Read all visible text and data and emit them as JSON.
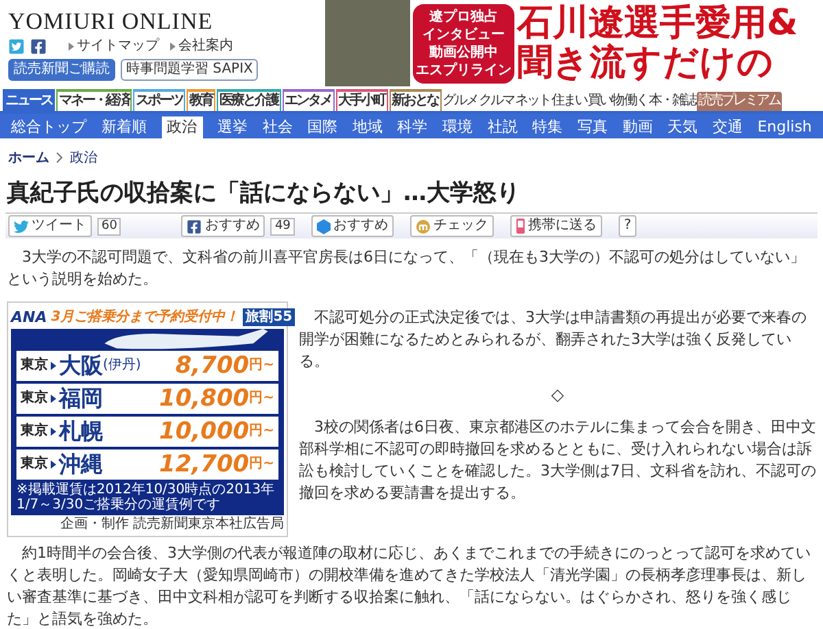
{
  "header": {
    "logo": "YOMIURI ONLINE",
    "links": [
      "サイトマップ",
      "会社案内"
    ],
    "buttons": [
      {
        "label": "読売新聞ご購読",
        "kind": "primary"
      },
      {
        "label": "時事問題学習 SAPIX",
        "kind": "outline"
      }
    ]
  },
  "banner_ad": {
    "badge_lines": [
      "遼プロ独占",
      "インタビュー",
      "動画公開中",
      "エスプリライン"
    ],
    "headline_lines": [
      "石川遼選手愛用&",
      "聞き流すだけの"
    ]
  },
  "nav_primary": {
    "tabs": [
      {
        "label": "ニュース",
        "selected": true,
        "color": "#3366cc"
      },
      {
        "label": "マネー・経済",
        "selected": false,
        "color": "#66aa44"
      },
      {
        "label": "スポーツ",
        "selected": false,
        "color": "#55aadd"
      },
      {
        "label": "教育",
        "selected": false,
        "color": "#ee9933"
      },
      {
        "label": "医療と介護",
        "selected": false,
        "color": "#33aaaa"
      },
      {
        "label": "エンタメ",
        "selected": false,
        "color": "#9966cc"
      },
      {
        "label": "大手小町",
        "selected": false,
        "color": "#dd5577"
      },
      {
        "label": "新おとな",
        "selected": false,
        "color": "#aa8855"
      }
    ],
    "links": [
      "グルメ",
      "クルマ",
      "ネット",
      "住まい",
      "買い物",
      "働く",
      "本・雑誌"
    ],
    "premium": "読売プレミアム"
  },
  "nav_sections": [
    {
      "label": "総合トップ",
      "selected": false
    },
    {
      "label": "新着順",
      "selected": false
    },
    {
      "label": "政治",
      "selected": true
    },
    {
      "label": "選挙",
      "selected": false
    },
    {
      "label": "社会",
      "selected": false
    },
    {
      "label": "国際",
      "selected": false
    },
    {
      "label": "地域",
      "selected": false
    },
    {
      "label": "科学",
      "selected": false
    },
    {
      "label": "環境",
      "selected": false
    },
    {
      "label": "社説",
      "selected": false
    },
    {
      "label": "特集",
      "selected": false
    },
    {
      "label": "写真",
      "selected": false
    },
    {
      "label": "動画",
      "selected": false
    },
    {
      "label": "天気",
      "selected": false
    },
    {
      "label": "交通",
      "selected": false
    },
    {
      "label": "English",
      "selected": false
    }
  ],
  "breadcrumb": [
    "ホーム",
    "政治"
  ],
  "title": "真紀子氏の収拾案に「話にならない」…大学怒り",
  "share_bar": [
    {
      "kind": "tweet",
      "label": "ツイート",
      "count": "60"
    },
    {
      "kind": "facebook",
      "label": "おすすめ",
      "count": "49"
    },
    {
      "kind": "hex",
      "label": "おすすめ"
    },
    {
      "kind": "check",
      "label": "チェック"
    },
    {
      "kind": "mobile",
      "label": "携帯に送る"
    },
    {
      "kind": "help",
      "label": "?"
    }
  ],
  "paragraphs": [
    {
      "kind": "text",
      "text": "3大学の不認可問題で、文科省の前川喜平官房長は6日になって、「（現在も3大学の）不認可の処分はしていない」という説明を始めた。"
    },
    {
      "kind": "text",
      "text": "不認可処分の正式決定後では、3大学は申請書類の再提出が必要で来春の開学が困難になるためとみられるが、翻弄された3大学は強く反発している。"
    },
    {
      "kind": "separator",
      "text": "◇"
    },
    {
      "kind": "text",
      "text": "3校の関係者は6日夜、東京都港区のホテルに集まって会合を開き、田中文部科学相に不認可の即時撤回を求めるとともに、受け入れられない場合は訴訟も検討していくことを確認した。3大学側は7日、文科省を訪れ、不認可の撤回を求める要請書を提出する。"
    },
    {
      "kind": "text",
      "text": "約1時間半の会合後、3大学側の代表が報道陣の取材に応じ、あくまでこれまでの手続きにのっとって認可を求めていくと表明した。岡崎女子大（愛知県岡崎市）の開校準備を進めてきた学校法人「清光学園」の長柄孝彦理事長は、新しい審査基準に基づき、田中文科相が認可を判断する収拾案に触れ、「話にならない。はぐらかされ、怒りを強く感じた」と語気を強めた。"
    }
  ],
  "ad": {
    "brand": "ANA",
    "tagline": "3月ご搭乗分まで予約受付中！",
    "badge": "旅割55",
    "routes": [
      {
        "from": "東京",
        "to": "大阪",
        "note": "(伊丹)",
        "price": "8,700",
        "unit": "円~"
      },
      {
        "from": "東京",
        "to": "福岡",
        "price": "10,800",
        "unit": "円~"
      },
      {
        "from": "東京",
        "to": "札幌",
        "price": "10,000",
        "unit": "円~"
      },
      {
        "from": "東京",
        "to": "沖縄",
        "price": "12,700",
        "unit": "円~"
      }
    ],
    "fine_print": "※掲載運賃は2012年10/30時点の2013年1/7～3/30ご搭乗分の運賃例です",
    "credit": "企画・制作 読売新聞東京本社広告局"
  }
}
